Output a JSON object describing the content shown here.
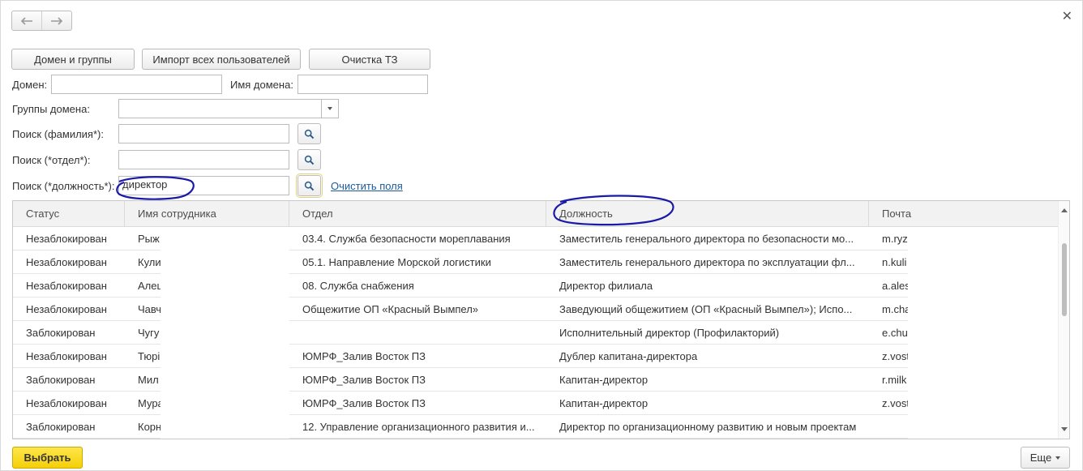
{
  "nav": {
    "back_icon": "arrow-left-icon",
    "forward_icon": "arrow-right-icon",
    "close_icon": "close-icon"
  },
  "toolbar": {
    "domain_groups": "Домен и группы",
    "import_users": "Импорт всех пользователей",
    "clear_tz": "Очистка ТЗ"
  },
  "filters": {
    "domain_label": "Домен:",
    "domain_value": "",
    "domain_name_label": "Имя домена:",
    "domain_name_value": "",
    "groups_label": "Группы домена:",
    "groups_value": "",
    "search_lastname_label": "Поиск (фамилия*):",
    "search_lastname_value": "",
    "search_dept_label": "Поиск (*отдел*):",
    "search_dept_value": "",
    "search_position_label": "Поиск (*должность*):",
    "search_position_value": "директор",
    "clear_fields": "Очистить поля"
  },
  "table": {
    "columns": [
      "Статус",
      "Имя сотрудника",
      "Отдел",
      "Должность",
      "Почта"
    ],
    "rows": [
      {
        "status": "Незаблокирован",
        "name": "Рыж",
        "dept": "03.4. Служба безопасности мореплавания",
        "position": "Заместитель генерального директора по безопасности мо...",
        "mail": "m.ryz"
      },
      {
        "status": "Незаблокирован",
        "name": "Кули",
        "dept": "05.1. Направление Морской логистики",
        "position": "Заместитель генерального директора по эксплуатации фл...",
        "mail": "n.kuli"
      },
      {
        "status": "Незаблокирован",
        "name": "Алец",
        "dept": "08. Служба снабжения",
        "position": "Директор филиала",
        "mail": "a.ales"
      },
      {
        "status": "Незаблокирован",
        "name": "Чавч",
        "dept": "Общежитие ОП «Красный Вымпел»",
        "position": "Заведующий общежитием (ОП «Красный Вымпел»); Испо...",
        "mail": "m.cha"
      },
      {
        "status": "Заблокирован",
        "name": "Чугу",
        "dept": "",
        "position": "Исполнительный директор (Профилакторий)",
        "mail": "e.chu"
      },
      {
        "status": "Незаблокирован",
        "name": "Тюрі",
        "dept": "ЮМРФ_Залив Восток ПЗ",
        "position": "Дублер капитана-директора",
        "mail": "z.vost"
      },
      {
        "status": "Заблокирован",
        "name": "Мил",
        "dept": "ЮМРФ_Залив Восток ПЗ",
        "position": "Капитан-директор",
        "mail": "r.milk"
      },
      {
        "status": "Незаблокирован",
        "name": "Мура",
        "dept": "ЮМРФ_Залив Восток ПЗ",
        "position": "Капитан-директор",
        "mail": "z.vost"
      },
      {
        "status": "Заблокирован",
        "name": "Корн",
        "dept": "12. Управление организационного развития и...",
        "position": "Директор по организационному развитию и новым проектам",
        "mail": ""
      }
    ]
  },
  "footer": {
    "select": "Выбрать",
    "more": "Еще"
  },
  "colors": {
    "accent_yellow": "#f7d31b",
    "link": "#1c5a9c",
    "ink_annotation": "#1a1aa8"
  }
}
